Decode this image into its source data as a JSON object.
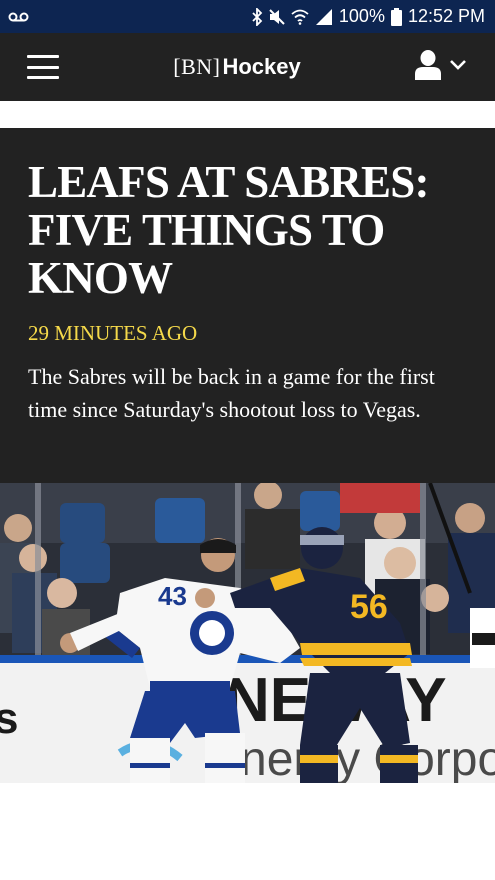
{
  "status_bar": {
    "battery": "100%",
    "time": "12:52 PM",
    "icons": [
      "voicemail-icon",
      "bluetooth-icon",
      "mute-icon",
      "wifi-icon",
      "signal-icon",
      "battery-icon"
    ]
  },
  "app_bar": {
    "logo_bracket": "[BN]",
    "logo_text": "Hockey",
    "icons": [
      "hamburger-menu-icon",
      "account-icon",
      "chevron-down-icon"
    ]
  },
  "article": {
    "headline_lines": [
      "LEAFS AT SABRES:",
      "FIVE THINGS TO",
      "KNOW"
    ],
    "timestamp": "29 MINUTES AGO",
    "summary": "The Sabres will be back in a game for the first time since Saturday's shootout loss to Vegas."
  },
  "photo": {
    "jersey_left_number": "43",
    "jersey_right_number": "56",
    "board_text": "NEWAY",
    "board_subtext": "nergy Corpo"
  },
  "colors": {
    "status_bar_bg": "#0d2551",
    "header_bg": "#222222",
    "timestamp": "#f5d94a",
    "leafs_blue": "#1a3a8f",
    "sabres_navy": "#1b2340",
    "sabres_gold": "#f3b823"
  }
}
